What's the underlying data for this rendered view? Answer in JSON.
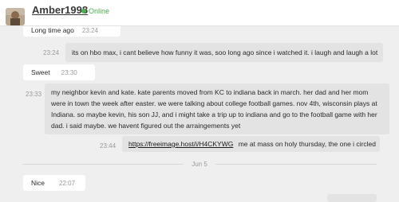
{
  "header": {
    "contact_name": "Amber1998",
    "status": "Online"
  },
  "messages": [
    {
      "text": "Long time ago",
      "time": "23:24"
    },
    {
      "text": "its on hbo max, i cant believe how funny it was, soo long ago since i watched it. i laugh and laugh a lot",
      "time": "23:24"
    },
    {
      "text": "Sweet",
      "time": "23:30"
    },
    {
      "text": "my neighbor kevin and kate. kate parents moved from KC to indiana back in march. her dad and her mom were in town the week after easter. we were talking about college football games. nov 4th, wisconsin plays at Indiana. so maybe kevin, his son JJ, and i might take a trip up to indiana and go to the football game with her dad. i said maybe. we havent figured out the arraingements yet",
      "time": "23:33"
    },
    {
      "link": "https://freeimage.host/i/H4CKYWG",
      "text": "me at mass on holy thursday, the one i circled",
      "time": "23:44"
    },
    {
      "text": "Nice",
      "time": "22:07"
    }
  ],
  "date_divider": "Jun 5",
  "colors": {
    "background": "#efefef",
    "incoming_bubble": "#ffffff",
    "outgoing_bubble": "#e3e3e3",
    "online": "#4caf50"
  }
}
